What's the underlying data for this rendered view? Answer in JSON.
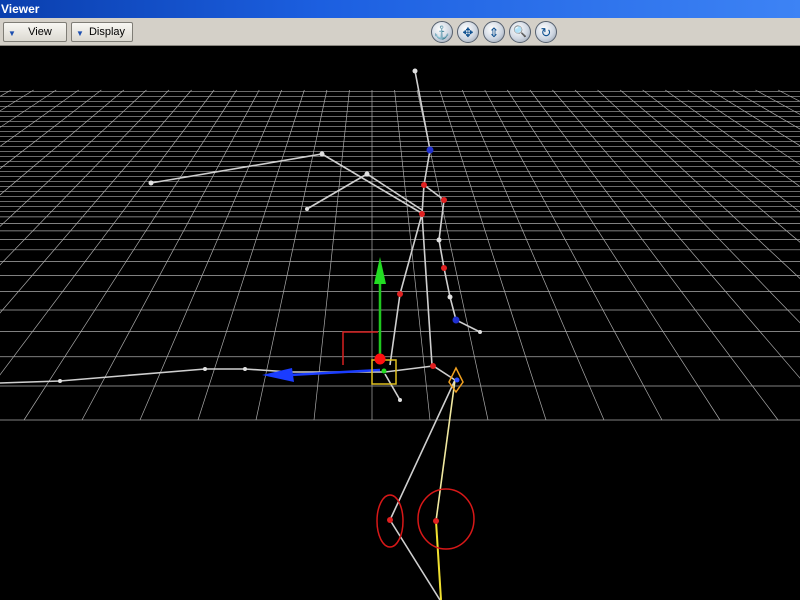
{
  "window": {
    "title": "Viewer"
  },
  "toolbar": {
    "view_label": "View",
    "display_label": "Display",
    "tools": [
      {
        "icon": "anchor-icon",
        "glyph": "⚓"
      },
      {
        "icon": "pan-icon",
        "glyph": "✥"
      },
      {
        "icon": "dolly-icon",
        "glyph": "⇕"
      },
      {
        "icon": "zoom-icon",
        "glyph": "🔍"
      },
      {
        "icon": "orbit-icon",
        "glyph": "↻"
      }
    ]
  },
  "colors": {
    "background": "#000000",
    "grid": "#c8c8c8",
    "bone": "#cfcfcf",
    "joint": "#e02020",
    "axis_x": "#1a3cff",
    "axis_y": "#1ec81e",
    "axis_z": "#d82020",
    "selection": "#f0e030"
  }
}
